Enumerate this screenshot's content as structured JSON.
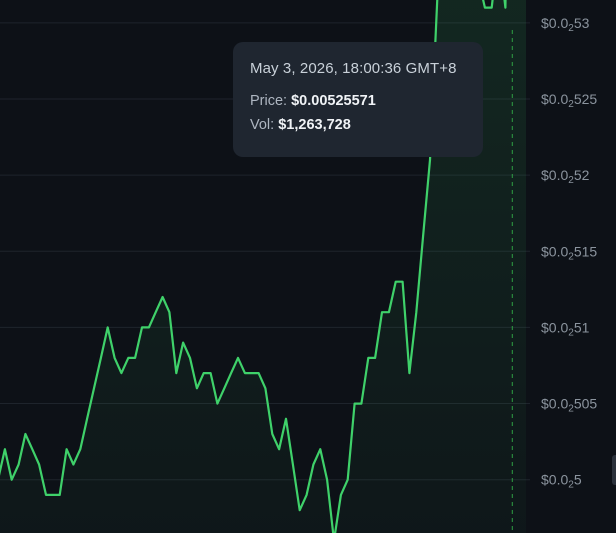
{
  "chart_data": {
    "type": "area",
    "series": [
      {
        "values": [
          0.005,
          0.00502,
          0.005,
          0.00501,
          0.00503,
          0.00502,
          0.00501,
          0.00499,
          0.00499,
          0.00499,
          0.00502,
          0.00501,
          0.00502,
          0.00504,
          0.00506,
          0.00508,
          0.0051,
          0.00508,
          0.00507,
          0.00508,
          0.00508,
          0.0051,
          0.0051,
          0.00511,
          0.00512,
          0.00511,
          0.00507,
          0.00509,
          0.00508,
          0.00506,
          0.00507,
          0.00507,
          0.00505,
          0.00506,
          0.00507,
          0.00508,
          0.00507,
          0.00507,
          0.00507,
          0.00506,
          0.00503,
          0.00502,
          0.00504,
          0.00501,
          0.00498,
          0.00499,
          0.00501,
          0.00502,
          0.005,
          0.00496,
          0.00499,
          0.005,
          0.00505,
          0.00505,
          0.00508,
          0.00508,
          0.00511,
          0.00511,
          0.00513,
          0.00513,
          0.00507,
          0.00511,
          0.00516,
          0.00521,
          0.00531,
          0.00541,
          0.0054,
          0.0054,
          0.00538,
          0.00536,
          0.00533,
          0.00531,
          0.00531,
          0.00535,
          0.00531,
          0.00558,
          0.00556,
          0.00559
        ]
      }
    ],
    "ylim": [
      0.004965,
      0.005315
    ],
    "yticks": [
      {
        "value": 0.005,
        "prefix": "$0.0",
        "sub": "2",
        "digits": "5"
      },
      {
        "value": 0.00505,
        "prefix": "$0.0",
        "sub": "2",
        "digits": "505"
      },
      {
        "value": 0.0051,
        "prefix": "$0.0",
        "sub": "2",
        "digits": "51"
      },
      {
        "value": 0.00515,
        "prefix": "$0.0",
        "sub": "2",
        "digits": "515"
      },
      {
        "value": 0.0052,
        "prefix": "$0.0",
        "sub": "2",
        "digits": "52"
      },
      {
        "value": 0.00525,
        "prefix": "$0.0",
        "sub": "2",
        "digits": "525"
      },
      {
        "value": 0.0053,
        "prefix": "$0.0",
        "sub": "2",
        "digits": "53"
      }
    ],
    "grid": true,
    "colors": {
      "line": "#3fd16a",
      "background": "#0d1117",
      "grid": "#1e242c",
      "crosshair": "#2ea043"
    },
    "hover_index": 75
  },
  "tooltip": {
    "time": "May 3, 2026, 18:00:36 GMT+8",
    "price_label": "Price:",
    "price_value": "$0.00525571",
    "vol_label": "Vol:",
    "vol_value": "$1,263,728"
  }
}
